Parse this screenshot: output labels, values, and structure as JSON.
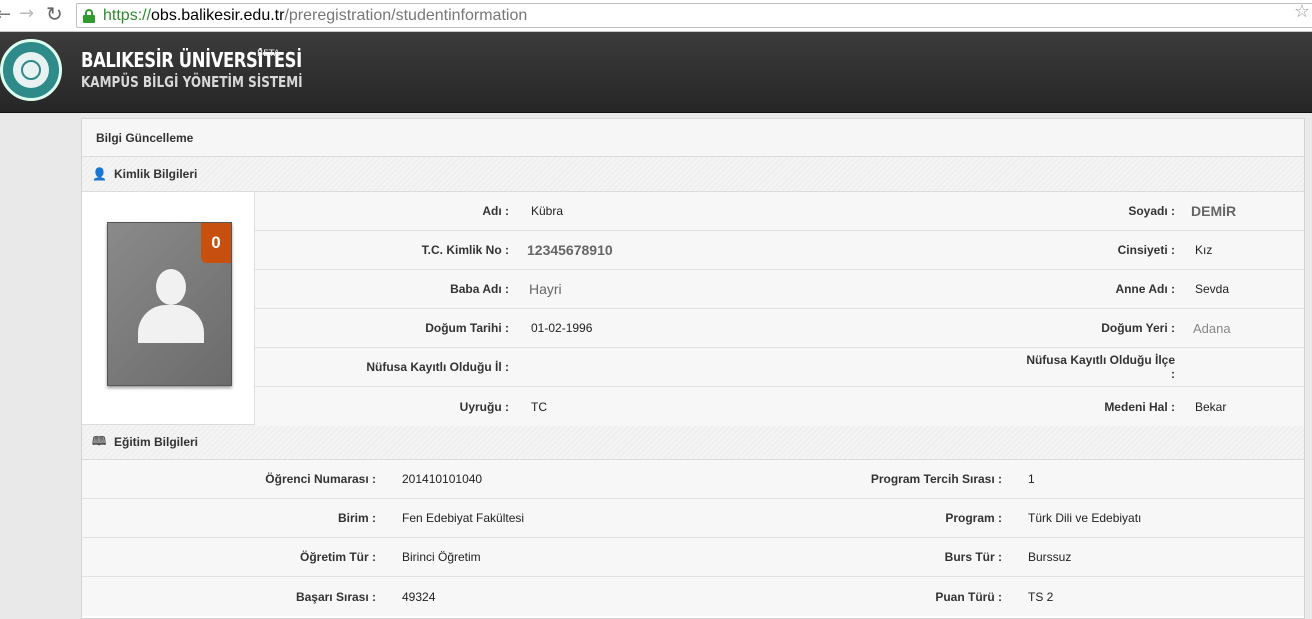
{
  "browser": {
    "back_glyph": "←",
    "forward_glyph": "→",
    "reload_glyph": "↻",
    "url_scheme": "https://",
    "url_host": "obs.balikesir.edu.tr",
    "url_path": "/preregistration/studentinformation",
    "star_glyph": "☆"
  },
  "header": {
    "title": "BALIKESİR ÜNİVERSİTESİ",
    "beta": "BETA",
    "subtitle": "KAMPÜS BİLGİ YÖNETİM SİSTEMİ"
  },
  "panel": {
    "title": "Bilgi Güncelleme"
  },
  "identity": {
    "section_title": "Kimlik Bilgileri",
    "icon": "user-icon",
    "photo_badge": "0",
    "rows": [
      {
        "label1": "Adı :",
        "value1": "Kübra",
        "label2": "Soyadı :",
        "value2": "DEMİR"
      },
      {
        "label1": "T.C. Kimlik No :",
        "value1": "12345678910",
        "label2": "Cinsiyeti :",
        "value2": "Kız"
      },
      {
        "label1": "Baba Adı :",
        "value1": "Hayri",
        "label2": "Anne Adı :",
        "value2": "Sevda"
      },
      {
        "label1": "Doğum Tarihi :",
        "value1": "01-02-1996",
        "label2": "Doğum Yeri :",
        "value2": "Adana"
      },
      {
        "label1": "Nüfusa Kayıtlı Olduğu İl :",
        "value1": "",
        "label2": "Nüfusa Kayıtlı Olduğu İlçe :",
        "value2": ""
      },
      {
        "label1": "Uyruğu :",
        "value1": "TC",
        "label2": "Medeni Hal :",
        "value2": "Bekar"
      }
    ]
  },
  "education": {
    "section_title": "Eğitim Bilgileri",
    "icon": "book-icon",
    "rows": [
      {
        "label1": "Öğrenci Numarası :",
        "value1": "201410101040",
        "label2": "Program Tercih Sırası :",
        "value2": "1"
      },
      {
        "label1": "Birim :",
        "value1": "Fen Edebiyat Fakültesi",
        "label2": "Program :",
        "value2": "Türk Dili ve Edebiyatı"
      },
      {
        "label1": "Öğretim Tür :",
        "value1": "Birinci Öğretim",
        "label2": "Burs Tür :",
        "value2": "Burssuz"
      },
      {
        "label1": "Başarı Sırası :",
        "value1": "49324",
        "label2": "Puan Türü :",
        "value2": "TS 2"
      }
    ]
  }
}
